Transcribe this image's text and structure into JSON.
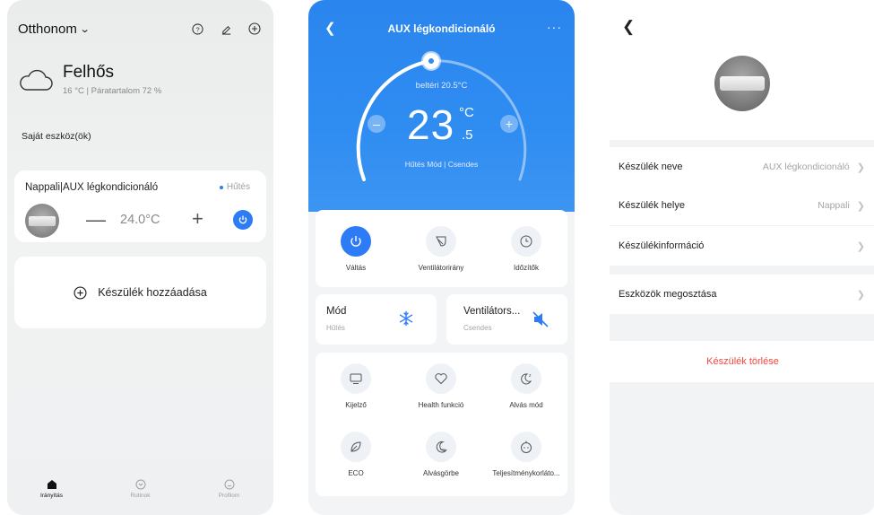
{
  "screen1": {
    "home": "Otthonom",
    "weather": {
      "condition": "Felhős",
      "detail": "16 °C | Páratartalom 72 %"
    },
    "own_devices": "Saját eszköz(ök)",
    "device": {
      "name": "Nappali|AUX légkondicionáló",
      "status": "Hűtés",
      "temp": "24.0°C"
    },
    "add_device": "Készülék hozzáadása",
    "tabs": [
      "Irányítás",
      "Rutinok",
      "Profilom"
    ]
  },
  "screen2": {
    "title": "AUX légkondicionáló",
    "indoor": "beltéri 20.5°C",
    "temp_int": "23",
    "temp_unit": "°C",
    "temp_dec": ".5",
    "mode_line": "Hűtés Mód | Csendes",
    "controls": [
      "Váltás",
      "Ventilátorirány",
      "Időzítők"
    ],
    "mode_card": {
      "title": "Mód",
      "sub": "Hűtés"
    },
    "fan_card": {
      "title": "Ventilátors...",
      "sub": "Csendes"
    },
    "functions": [
      "Kijelző",
      "Health funkció",
      "Alvás mód",
      "ECO",
      "Alvásgörbe",
      "Teljesítménykorlátо..."
    ]
  },
  "screen3": {
    "rows": [
      {
        "label": "Készülék neve",
        "value": "AUX légkondicionáló"
      },
      {
        "label": "Készülék helye",
        "value": "Nappali"
      },
      {
        "label": "Készülékinformáció",
        "value": ""
      },
      {
        "label": "Eszközök megosztása",
        "value": ""
      }
    ],
    "delete": "Készülék törlése"
  },
  "colors": {
    "accent": "#2e7bf6",
    "danger": "#f1483f",
    "ac_header": "#2f8cf1"
  }
}
